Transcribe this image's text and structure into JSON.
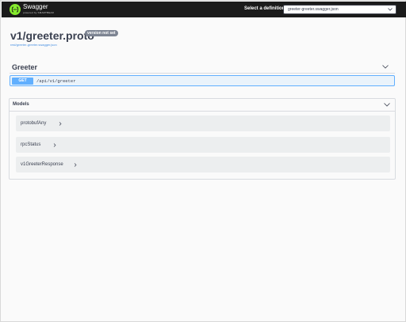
{
  "topbar": {
    "brand": "Swagger",
    "brand_sub": "powered by SMARTBEAR",
    "definition_label": "Select a definition",
    "definition_value": "greeter-greeter.swagger.json"
  },
  "info": {
    "title": "v1/greeter.proto",
    "version_badge": "version not set",
    "spec_link": "rest/greeter-greeter.swagger.json"
  },
  "tag": {
    "name": "Greeter",
    "operations": [
      {
        "method": "GET",
        "path": "/api/v1/greeter"
      }
    ]
  },
  "models": {
    "title": "Models",
    "items": [
      "protobufAny",
      "rpcStatus",
      "v1GreeterResponse"
    ]
  },
  "colors": {
    "topbar": "#1b1b1b",
    "brand_green": "#85ea2d",
    "get_blue": "#61affe",
    "link_blue": "#4990e2"
  }
}
